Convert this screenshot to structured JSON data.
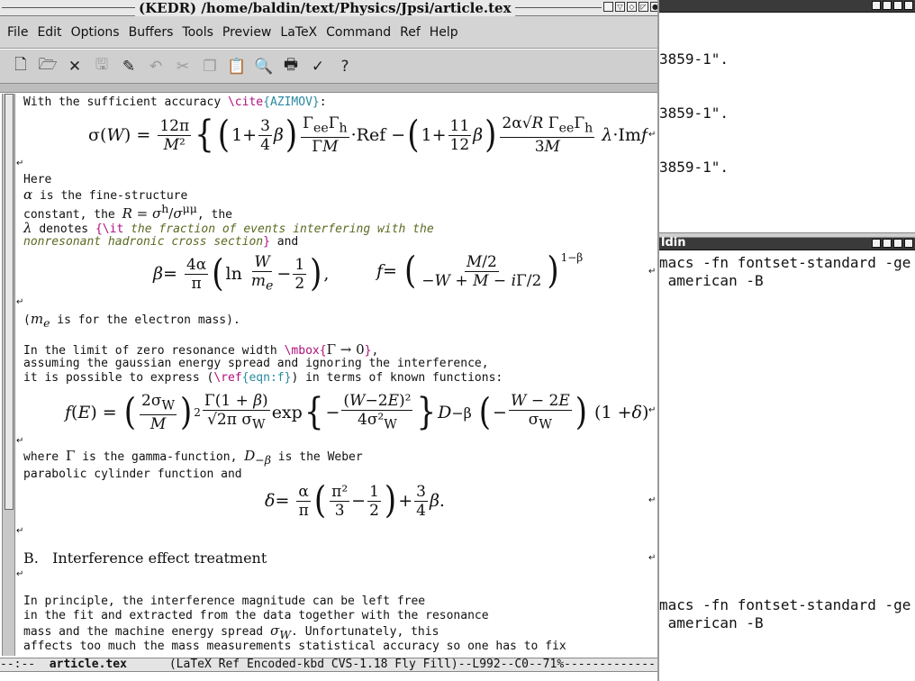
{
  "window": {
    "title": "(KEDR) /home/baldin/text/Physics/Jpsi/article.tex"
  },
  "menubar": [
    "File",
    "Edit",
    "Options",
    "Buffers",
    "Tools",
    "Preview",
    "LaTeX",
    "Command",
    "Ref",
    "Help"
  ],
  "toolbar": {
    "icons": [
      "new-file-icon",
      "open-folder-icon",
      "close-icon",
      "save-icon",
      "save-as-icon",
      "undo-icon",
      "cut-icon",
      "copy-icon",
      "paste-icon",
      "search-icon",
      "print-icon",
      "spell-check-icon",
      "help-icon"
    ]
  },
  "editor": {
    "line1_pre": "With the sufficient accuracy ",
    "line1_cmd": "\\cite",
    "line1_arg": "{AZIMOV}",
    "line1_post": ":",
    "here": "Here",
    "alpha_line": " is the fine-structure",
    "const_pre": "constant, the ",
    "const_post": ", the",
    "lambda_pre": " denotes ",
    "lambda_brace": "{",
    "lambda_cmd": "\\it",
    "lambda_it1": " the fraction of events interfering with the",
    "lambda_it2": "nonresonant hadronic cross section",
    "lambda_close": "}",
    "lambda_post": " and",
    "me_line_pre": "(",
    "me_line_post": " is for the electron mass).",
    "limit_pre": "In the limit of zero resonance width ",
    "limit_cmd": "\\mbox",
    "limit_post": ",",
    "gauss": "assuming the gaussian energy spread and ignoring the interference,",
    "express_pre": "it is possible to express (",
    "express_cmd": "\\ref",
    "express_arg": "{eqn:f}",
    "express_post": ") in terms of known functions:",
    "where_pre": "where ",
    "where_mid": " is the gamma-function, ",
    "where_post": " is the Weber",
    "parabolic": "parabolic cylinder function and",
    "section_num": "B.",
    "section_title": "Interference effect treatment",
    "p1": "In principle, the interference magnitude can be left free",
    "p2": "in the fit and extracted from the data together with the resonance",
    "p3_pre": "mass and the machine energy spread ",
    "p3_post": ". Unfortunately, this",
    "p4": "affects too much the mass measurements statistical accuracy so one has to fix"
  },
  "modeline": {
    "prefix": "--:--  ",
    "buffer": "article.tex",
    "modes": "      (LaTeX Ref Encoded-kbd CVS-1.18 Fly Fill)--L992--C0--71%",
    "dashes": "-------------------"
  },
  "background_window": {
    "title": "ldin",
    "lines_top": [
      "3859-1\".",
      "3859-1\".",
      "3859-1\"."
    ],
    "lines_mid": [
      "macs -fn fontset-standard -ge",
      " american -B"
    ],
    "lines_bot": [
      "macs -fn fontset-standard -ge",
      " american -B"
    ]
  }
}
